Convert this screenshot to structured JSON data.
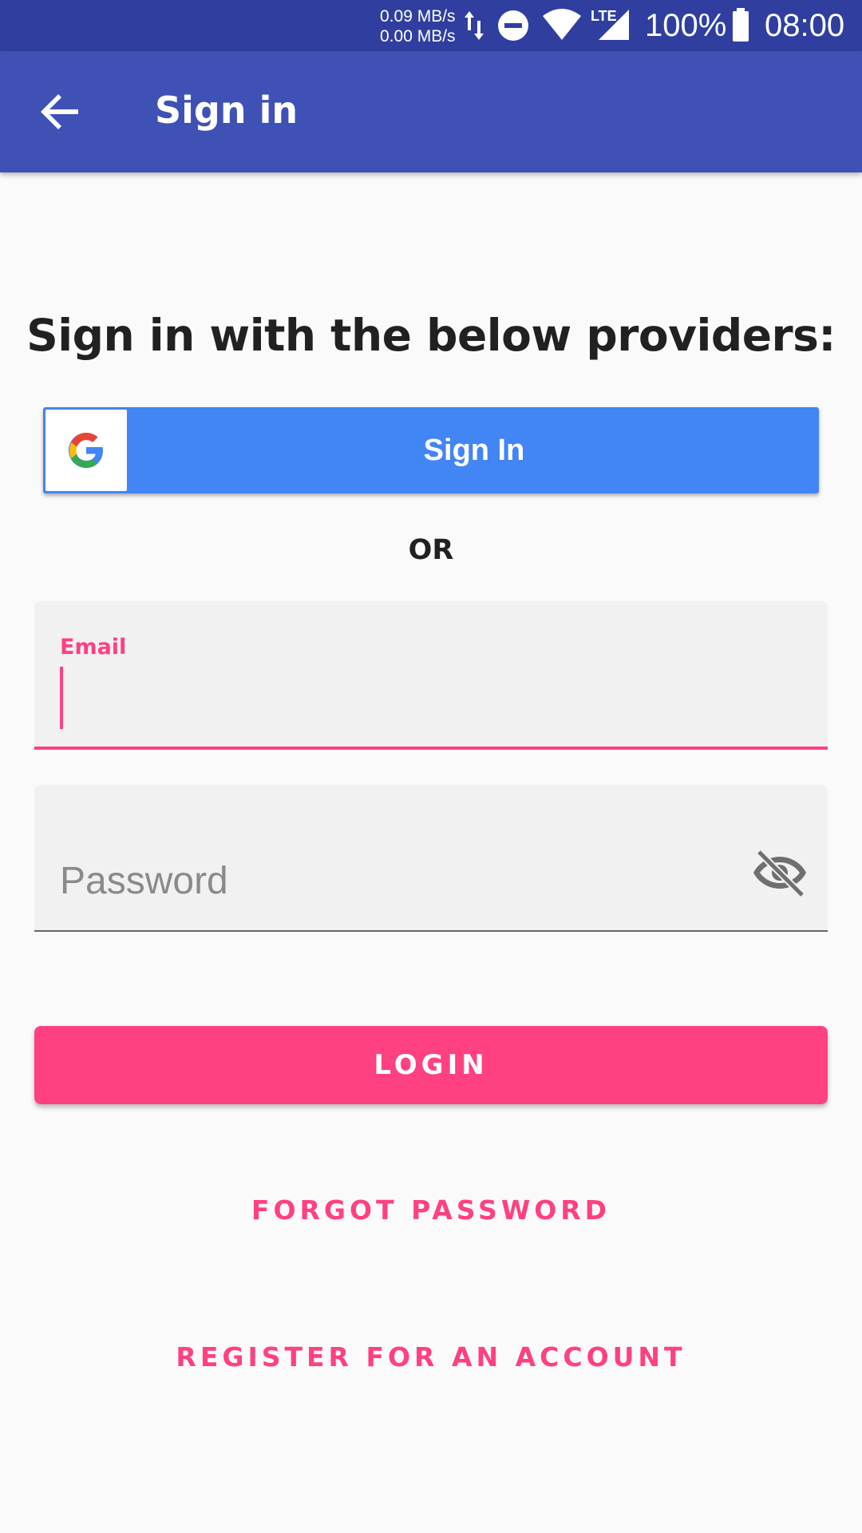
{
  "status_bar": {
    "net_up": "0.09 MB/s",
    "net_down": "0.00 MB/s",
    "network_type": "LTE",
    "battery": "100%",
    "time": "08:00",
    "icons": [
      "data-transfer-icon",
      "do-not-disturb-icon",
      "wifi-icon",
      "cellular-signal-icon",
      "battery-icon"
    ]
  },
  "app_bar": {
    "title": "Sign in",
    "back_icon": "arrow-back-icon"
  },
  "providers": {
    "heading": "Sign in with the below providers:",
    "google_button_label": "Sign In",
    "google_icon": "google-logo-icon"
  },
  "divider_text": "OR",
  "email_field": {
    "label": "Email",
    "value": ""
  },
  "password_field": {
    "placeholder": "Password",
    "value": "",
    "toggle_icon": "visibility-off-icon"
  },
  "login_button_label": "LOGIN",
  "forgot_password_label": "FORGOT PASSWORD",
  "register_label": "REGISTER FOR AN ACCOUNT",
  "colors": {
    "status_bar": "#303f9f",
    "app_bar": "#3f51b5",
    "accent": "#ff4081",
    "google_blue": "#4285f4",
    "background": "#fafafa"
  }
}
